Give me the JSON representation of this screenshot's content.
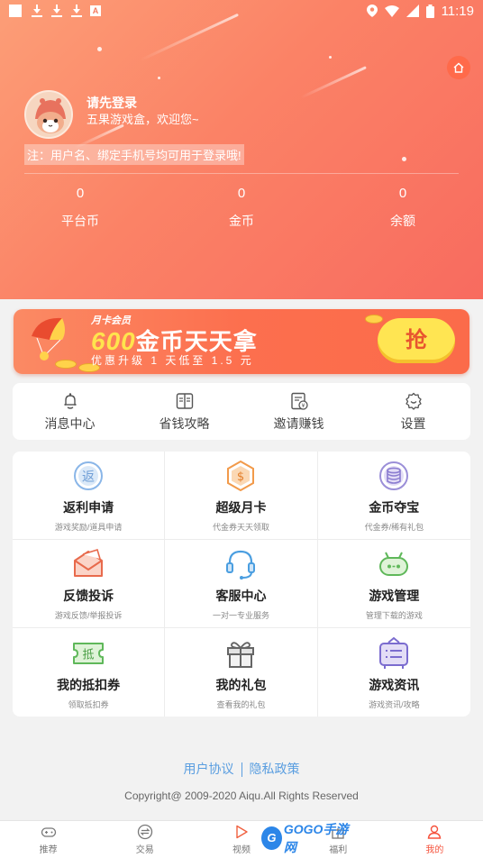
{
  "status_bar": {
    "time": "11:19"
  },
  "profile": {
    "title": "请先登录",
    "subtitle": "五果游戏盒，欢迎您~",
    "note": "注：用户名、绑定手机号均可用于登录哦!"
  },
  "stats": [
    {
      "value": "0",
      "label": "平台币"
    },
    {
      "value": "0",
      "label": "金币"
    },
    {
      "value": "0",
      "label": "余额"
    }
  ],
  "banner": {
    "tag": "月卡会员",
    "amount": "600",
    "headline": "金币天天拿",
    "subline": "优惠升级 1 天低至 1.5 元",
    "button": "抢"
  },
  "quick_actions": [
    {
      "label": "消息中心",
      "icon": "bell-icon"
    },
    {
      "label": "省钱攻略",
      "icon": "book-icon"
    },
    {
      "label": "邀请赚钱",
      "icon": "invite-money-icon"
    },
    {
      "label": "设置",
      "icon": "gear-icon"
    }
  ],
  "services": [
    {
      "title": "返利申请",
      "desc": "游戏奖励/道具申请",
      "icon": "rebate-icon"
    },
    {
      "title": "超级月卡",
      "desc": "代金券天天领取",
      "icon": "monthly-card-icon"
    },
    {
      "title": "金币夺宝",
      "desc": "代金券/稀有礼包",
      "icon": "coin-treasure-icon"
    },
    {
      "title": "反馈投诉",
      "desc": "游戏反馈/举报投诉",
      "icon": "feedback-icon"
    },
    {
      "title": "客服中心",
      "desc": "一对一专业服务",
      "icon": "headset-icon"
    },
    {
      "title": "游戏管理",
      "desc": "管理下载的游戏",
      "icon": "game-manage-icon"
    },
    {
      "title": "我的抵扣券",
      "desc": "领取抵扣券",
      "icon": "voucher-icon"
    },
    {
      "title": "我的礼包",
      "desc": "查看我的礼包",
      "icon": "gift-icon"
    },
    {
      "title": "游戏资讯",
      "desc": "游戏资讯/攻略",
      "icon": "news-icon"
    }
  ],
  "footer": {
    "user_agreement": "用户协议",
    "privacy_policy": "隐私政策",
    "copyright": "Copyright@ 2009-2020 Aiqu.All Rights Reserved"
  },
  "bottom_nav": [
    {
      "label": "推荐",
      "icon": "gamepad-icon"
    },
    {
      "label": "交易",
      "icon": "exchange-icon"
    },
    {
      "label": "视频",
      "icon": "play-icon"
    },
    {
      "label": "福利",
      "icon": "gift-nav-icon"
    },
    {
      "label": "我的",
      "icon": "user-icon",
      "active": true
    }
  ],
  "watermark": "GOGO手游网",
  "colors": {
    "accent": "#f86b5f",
    "link": "#5a9ee0",
    "active_nav": "#f5533d"
  }
}
